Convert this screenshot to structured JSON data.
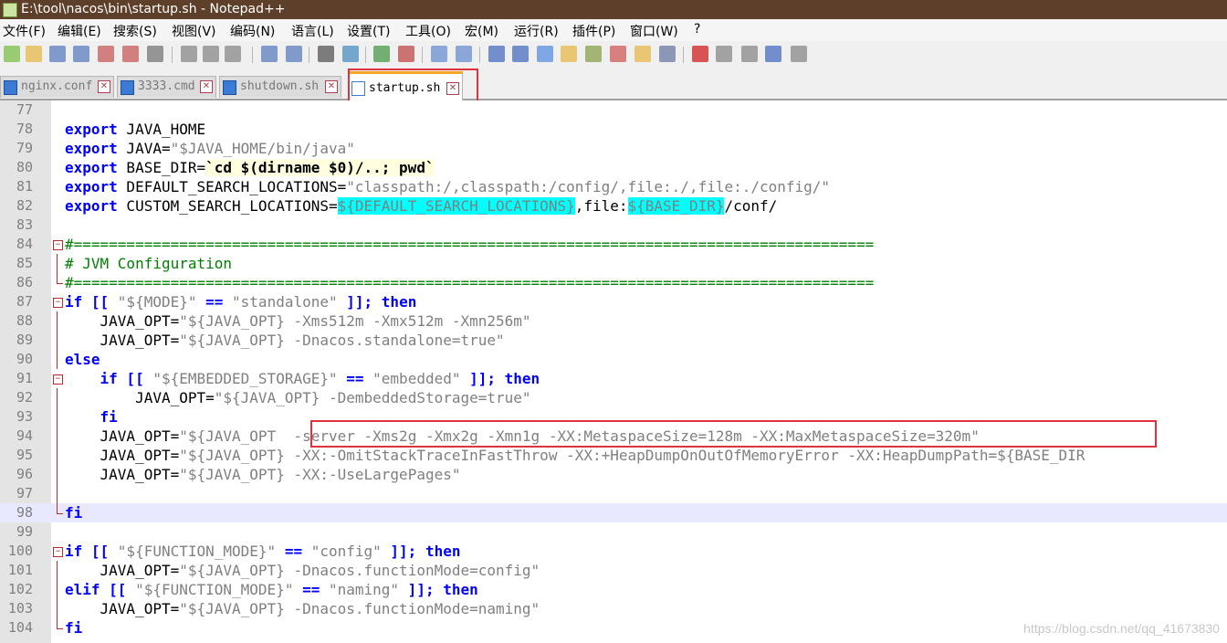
{
  "window": {
    "title": "E:\\tool\\nacos\\bin\\startup.sh - Notepad++"
  },
  "menu": [
    "文件(F)",
    "编辑(E)",
    "搜索(S)",
    "视图(V)",
    "编码(N)",
    "语言(L)",
    "设置(T)",
    "工具(O)",
    "宏(M)",
    "运行(R)",
    "插件(P)",
    "窗口(W)",
    "?"
  ],
  "tabs": [
    {
      "label": "nginx.conf",
      "active": false
    },
    {
      "label": "3333.cmd",
      "active": false
    },
    {
      "label": "shutdown.sh",
      "active": false
    },
    {
      "label": "startup.sh",
      "active": true
    }
  ],
  "toolbar_icons": [
    "new-file-icon",
    "open-file-icon",
    "save-icon",
    "save-all-icon",
    "close-icon",
    "close-all-icon",
    "print-icon",
    "cut-icon",
    "copy-icon",
    "paste-icon",
    "undo-icon",
    "redo-icon",
    "find-icon",
    "replace-icon",
    "zoom-in-icon",
    "zoom-out-icon",
    "sync-vertical-icon",
    "sync-horizontal-icon",
    "word-wrap-icon",
    "show-all-chars-icon",
    "indent-guide-icon",
    "user-language-icon",
    "doc-map-icon",
    "function-list-icon",
    "folder-workspace-icon",
    "monitoring-icon",
    "record-macro-icon",
    "stop-macro-icon",
    "play-macro-icon",
    "run-macro-multiple-icon",
    "save-macro-icon"
  ],
  "lines": [
    {
      "n": "77",
      "fold": "line",
      "segs": []
    },
    {
      "n": "78",
      "fold": "line",
      "segs": [
        {
          "t": "export",
          "c": "kw"
        },
        {
          "t": " JAVA_HOME",
          "c": "var"
        }
      ]
    },
    {
      "n": "79",
      "fold": "line",
      "segs": [
        {
          "t": "export",
          "c": "kw"
        },
        {
          "t": " JAVA=",
          "c": "var"
        },
        {
          "t": "\"$JAVA_HOME/bin/java\"",
          "c": "str"
        }
      ]
    },
    {
      "n": "80",
      "fold": "line",
      "segs": [
        {
          "t": "export",
          "c": "kw"
        },
        {
          "t": " BASE_DIR=",
          "c": "var"
        },
        {
          "t": "`cd $(dirname $0)/..; pwd`",
          "c": "bt"
        }
      ]
    },
    {
      "n": "81",
      "fold": "line",
      "segs": [
        {
          "t": "export",
          "c": "kw"
        },
        {
          "t": " DEFAULT_SEARCH_LOCATIONS=",
          "c": "var"
        },
        {
          "t": "\"classpath:/,classpath:/config/,file:./,file:./config/\"",
          "c": "str"
        }
      ]
    },
    {
      "n": "82",
      "fold": "line",
      "segs": [
        {
          "t": "export",
          "c": "kw"
        },
        {
          "t": " CUSTOM_SEARCH_LOCATIONS=",
          "c": "var"
        },
        {
          "t": "${DEFAULT_SEARCH_LOCATIONS}",
          "c": "hl"
        },
        {
          "t": ",file:",
          "c": "var"
        },
        {
          "t": "${BASE_DIR}",
          "c": "hl"
        },
        {
          "t": "/conf/",
          "c": "var"
        }
      ]
    },
    {
      "n": "83",
      "fold": "line",
      "segs": []
    },
    {
      "n": "84",
      "fold": "open",
      "segs": [
        {
          "t": "#===========================================================================================",
          "c": "cmt"
        }
      ]
    },
    {
      "n": "85",
      "fold": "line",
      "segs": [
        {
          "t": "# JVM Configuration",
          "c": "cmt"
        }
      ]
    },
    {
      "n": "86",
      "fold": "end",
      "segs": [
        {
          "t": "#===========================================================================================",
          "c": "cmt"
        }
      ]
    },
    {
      "n": "87",
      "fold": "open",
      "segs": [
        {
          "t": "if",
          "c": "kw"
        },
        {
          "t": " [[ ",
          "c": "kw"
        },
        {
          "t": "\"${MODE}\"",
          "c": "str"
        },
        {
          "t": " == ",
          "c": "kw"
        },
        {
          "t": "\"standalone\"",
          "c": "str"
        },
        {
          "t": " ]]; ",
          "c": "kw"
        },
        {
          "t": "then",
          "c": "kw"
        }
      ]
    },
    {
      "n": "88",
      "fold": "line",
      "segs": [
        {
          "t": "    JAVA_OPT=",
          "c": "var"
        },
        {
          "t": "\"${JAVA_OPT} -Xms512m -Xmx512m -Xmn256m\"",
          "c": "str"
        }
      ]
    },
    {
      "n": "89",
      "fold": "line",
      "segs": [
        {
          "t": "    JAVA_OPT=",
          "c": "var"
        },
        {
          "t": "\"${JAVA_OPT} -Dnacos.standalone=true\"",
          "c": "str"
        }
      ]
    },
    {
      "n": "90",
      "fold": "line",
      "segs": [
        {
          "t": "else",
          "c": "kw"
        }
      ]
    },
    {
      "n": "91",
      "fold": "open",
      "segs": [
        {
          "t": "    ",
          "c": "var"
        },
        {
          "t": "if",
          "c": "kw"
        },
        {
          "t": " [[ ",
          "c": "kw"
        },
        {
          "t": "\"${EMBEDDED_STORAGE}\"",
          "c": "str"
        },
        {
          "t": " == ",
          "c": "kw"
        },
        {
          "t": "\"embedded\"",
          "c": "str"
        },
        {
          "t": " ]]; ",
          "c": "kw"
        },
        {
          "t": "then",
          "c": "kw"
        }
      ]
    },
    {
      "n": "92",
      "fold": "line",
      "segs": [
        {
          "t": "        JAVA_OPT=",
          "c": "var"
        },
        {
          "t": "\"${JAVA_OPT} -DembeddedStorage=true\"",
          "c": "str"
        }
      ]
    },
    {
      "n": "93",
      "fold": "line",
      "segs": [
        {
          "t": "    ",
          "c": "var"
        },
        {
          "t": "fi",
          "c": "kw"
        }
      ]
    },
    {
      "n": "94",
      "fold": "line",
      "segs": [
        {
          "t": "    JAVA_OPT=",
          "c": "var"
        },
        {
          "t": "\"${JAVA_OPT  -server -Xms2g -Xmx2g -Xmn1g -XX:MetaspaceSize=128m -XX:MaxMetaspaceSize=320m\"",
          "c": "str"
        }
      ]
    },
    {
      "n": "95",
      "fold": "line",
      "segs": [
        {
          "t": "    JAVA_OPT=",
          "c": "var"
        },
        {
          "t": "\"${JAVA_OPT} -XX:-OmitStackTraceInFastThrow -XX:+HeapDumpOnOutOfMemoryError -XX:HeapDumpPath=${BASE_DIR",
          "c": "str"
        }
      ]
    },
    {
      "n": "96",
      "fold": "line",
      "segs": [
        {
          "t": "    JAVA_OPT=",
          "c": "var"
        },
        {
          "t": "\"${JAVA_OPT} -XX:-UseLargePages\"",
          "c": "str"
        }
      ]
    },
    {
      "n": "97",
      "fold": "line",
      "segs": []
    },
    {
      "n": "98",
      "fold": "end",
      "current": true,
      "segs": [
        {
          "t": "fi",
          "c": "kw"
        }
      ]
    },
    {
      "n": "99",
      "fold": "none",
      "segs": []
    },
    {
      "n": "100",
      "fold": "open",
      "segs": [
        {
          "t": "if",
          "c": "kw"
        },
        {
          "t": " [[ ",
          "c": "kw"
        },
        {
          "t": "\"${FUNCTION_MODE}\"",
          "c": "str"
        },
        {
          "t": " == ",
          "c": "kw"
        },
        {
          "t": "\"config\"",
          "c": "str"
        },
        {
          "t": " ]]; ",
          "c": "kw"
        },
        {
          "t": "then",
          "c": "kw"
        }
      ]
    },
    {
      "n": "101",
      "fold": "line",
      "segs": [
        {
          "t": "    JAVA_OPT=",
          "c": "var"
        },
        {
          "t": "\"${JAVA_OPT} -Dnacos.functionMode=config\"",
          "c": "str"
        }
      ]
    },
    {
      "n": "102",
      "fold": "line",
      "segs": [
        {
          "t": "elif",
          "c": "kw"
        },
        {
          "t": " [[ ",
          "c": "kw"
        },
        {
          "t": "\"${FUNCTION_MODE}\"",
          "c": "str"
        },
        {
          "t": " == ",
          "c": "kw"
        },
        {
          "t": "\"naming\"",
          "c": "str"
        },
        {
          "t": " ]]; ",
          "c": "kw"
        },
        {
          "t": "then",
          "c": "kw"
        }
      ]
    },
    {
      "n": "103",
      "fold": "line",
      "segs": [
        {
          "t": "    JAVA_OPT=",
          "c": "var"
        },
        {
          "t": "\"${JAVA_OPT} -Dnacos.functionMode=naming\"",
          "c": "str"
        }
      ]
    },
    {
      "n": "104",
      "fold": "end",
      "segs": [
        {
          "t": "fi",
          "c": "kw"
        }
      ]
    }
  ],
  "watermark": "https://blog.csdn.net/qq_41673830"
}
